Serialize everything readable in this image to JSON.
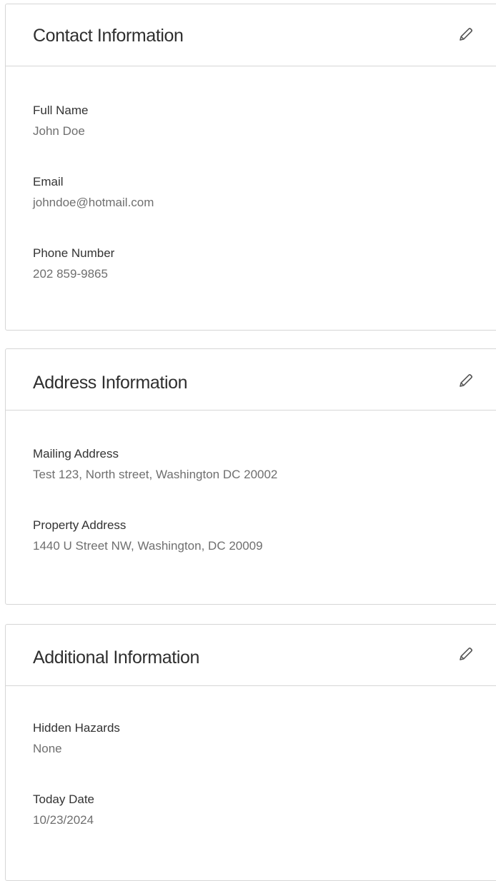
{
  "contact": {
    "title": "Contact Information",
    "edit_icon": "pencil-icon",
    "fields": [
      {
        "label": "Full Name",
        "value": "John Doe"
      },
      {
        "label": "Email",
        "value": "johndoe@hotmail.com"
      },
      {
        "label": "Phone Number",
        "value": "202 859-9865"
      }
    ]
  },
  "address": {
    "title": "Address Information",
    "edit_icon": "pencil-icon",
    "fields": [
      {
        "label": "Mailing Address",
        "value": "Test 123, North street, Washington DC 20002"
      },
      {
        "label": "Property Address",
        "value": "1440 U Street NW, Washington, DC 20009"
      }
    ]
  },
  "additional": {
    "title": "Additional Information",
    "edit_icon": "pencil-icon",
    "fields": [
      {
        "label": "Hidden Hazards",
        "value": "None"
      },
      {
        "label": "Today Date",
        "value": "10/23/2024"
      }
    ]
  },
  "colors": {
    "border": "#d6d6d6",
    "title": "#2f2f2f",
    "label": "#333333",
    "value": "#6f6f6f"
  }
}
